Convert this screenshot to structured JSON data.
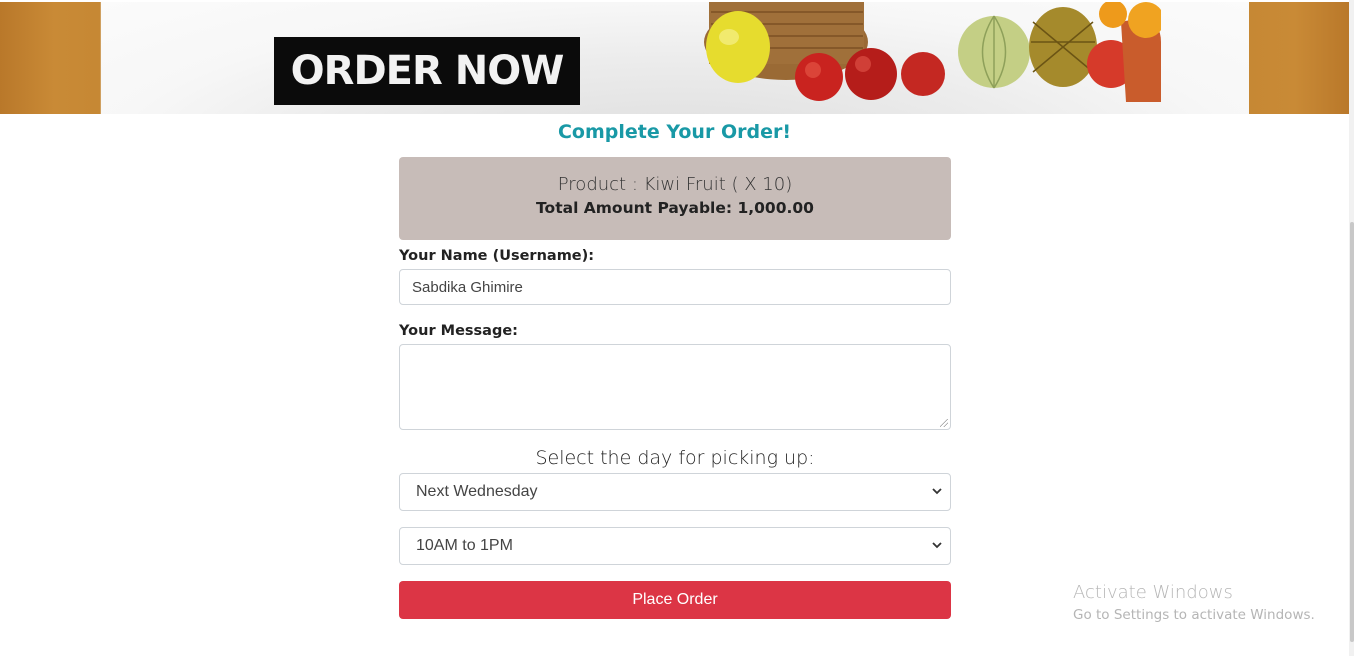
{
  "banner": {
    "cta": "ORDER NOW"
  },
  "order": {
    "title": "Complete Your Order!",
    "product_line": "Product : Kiwi Fruit ( X 10)",
    "total_line": "Total Amount Payable: 1,000.00"
  },
  "form": {
    "name_label": "Your Name (Username):",
    "name_value": "Sabdika Ghimire",
    "message_label": "Your Message:",
    "message_value": "",
    "pickup_label": "Select the day for picking up:",
    "day_selected": "Next Wednesday",
    "time_selected": "10AM to 1PM",
    "submit_label": "Place Order"
  },
  "watermark": {
    "title": "Activate Windows",
    "subtitle": "Go to Settings to activate Windows."
  },
  "colors": {
    "accent_title": "#1999a6",
    "summary_bg": "#c7bcb8",
    "button_red": "#dc3545"
  }
}
